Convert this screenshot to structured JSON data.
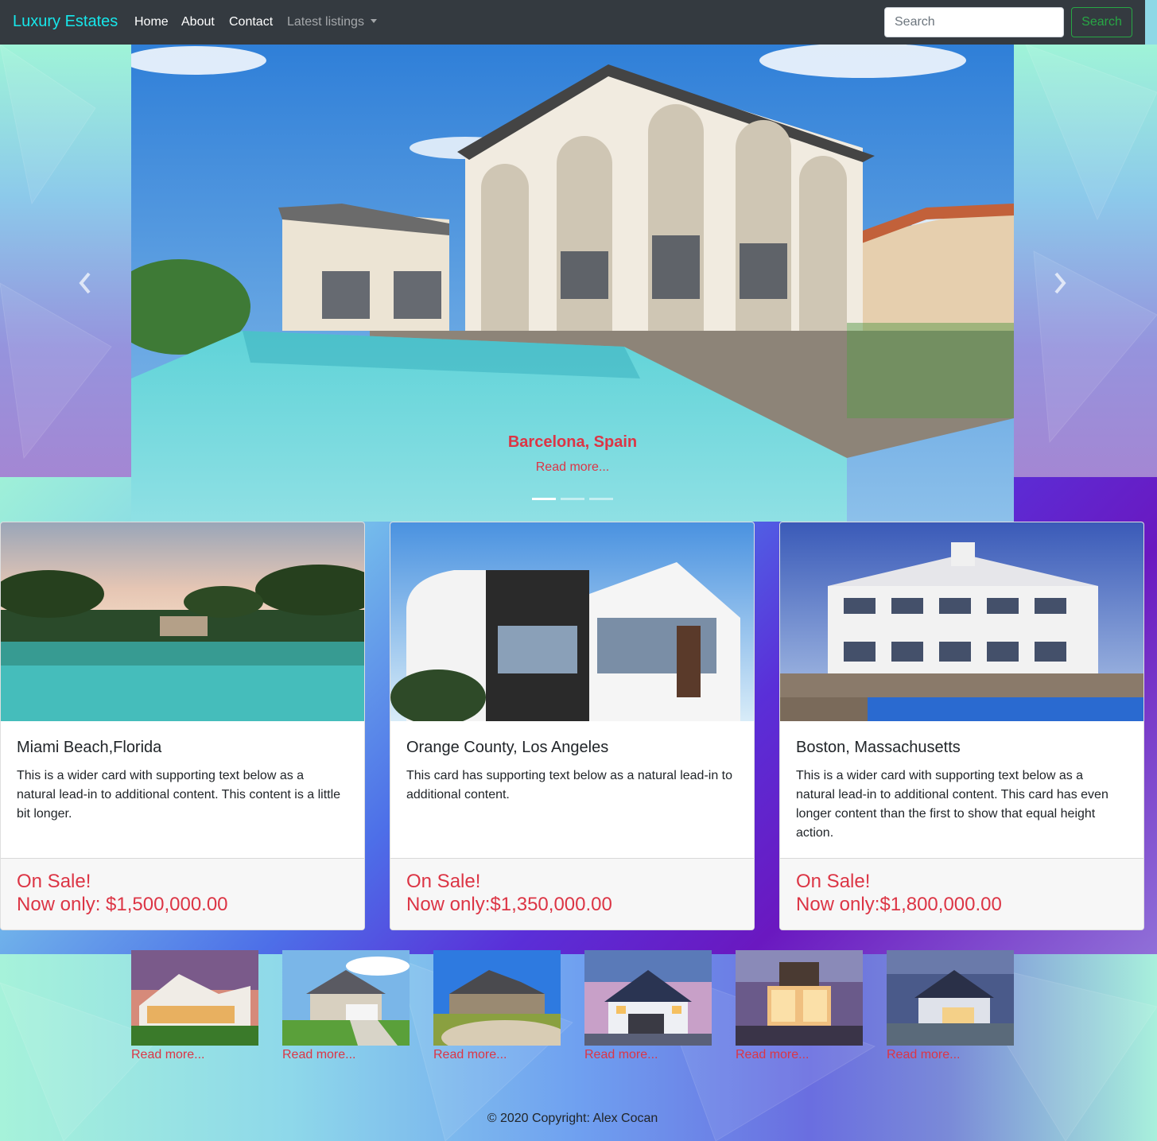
{
  "navbar": {
    "brand": "Luxury Estates",
    "links": [
      {
        "label": "Home"
      },
      {
        "label": "About"
      },
      {
        "label": "Contact"
      }
    ],
    "dropdown_label": "Latest listings",
    "search_placeholder": "Search",
    "search_button": "Search"
  },
  "carousel": {
    "caption_title": "Barcelona, Spain",
    "caption_link": "Read more...",
    "slide_count": 3,
    "active_slide": 1
  },
  "cards": [
    {
      "title": "Miami Beach,Florida",
      "text": "This is a wider card with supporting text below as a natural lead-in to additional content. This content is a little bit longer.",
      "sale_line": "On Sale!",
      "price_line": "Now only: $1,500,000.00"
    },
    {
      "title": "Orange County, Los Angeles",
      "text": "This card has supporting text below as a natural lead-in to additional content.",
      "sale_line": "On Sale!",
      "price_line": "Now only:$1,350,000.00"
    },
    {
      "title": "Boston, Massachusetts",
      "text": "This is a wider card with supporting text below as a natural lead-in to additional content. This card has even longer content than the first to show that equal height action.",
      "sale_line": "On Sale!",
      "price_line": "Now only:$1,800,000.00"
    }
  ],
  "thumbnails": [
    {
      "link": "Read more..."
    },
    {
      "link": "Read more..."
    },
    {
      "link": "Read more..."
    },
    {
      "link": "Read more..."
    },
    {
      "link": "Read more..."
    },
    {
      "link": "Read more..."
    }
  ],
  "footer": {
    "text": "© 2020 Copyright: Alex Cocan"
  },
  "colors": {
    "navbar_bg": "#343a40",
    "brand": "#17e6ea",
    "accent_red": "#dc3545",
    "search_green": "#28a745"
  }
}
